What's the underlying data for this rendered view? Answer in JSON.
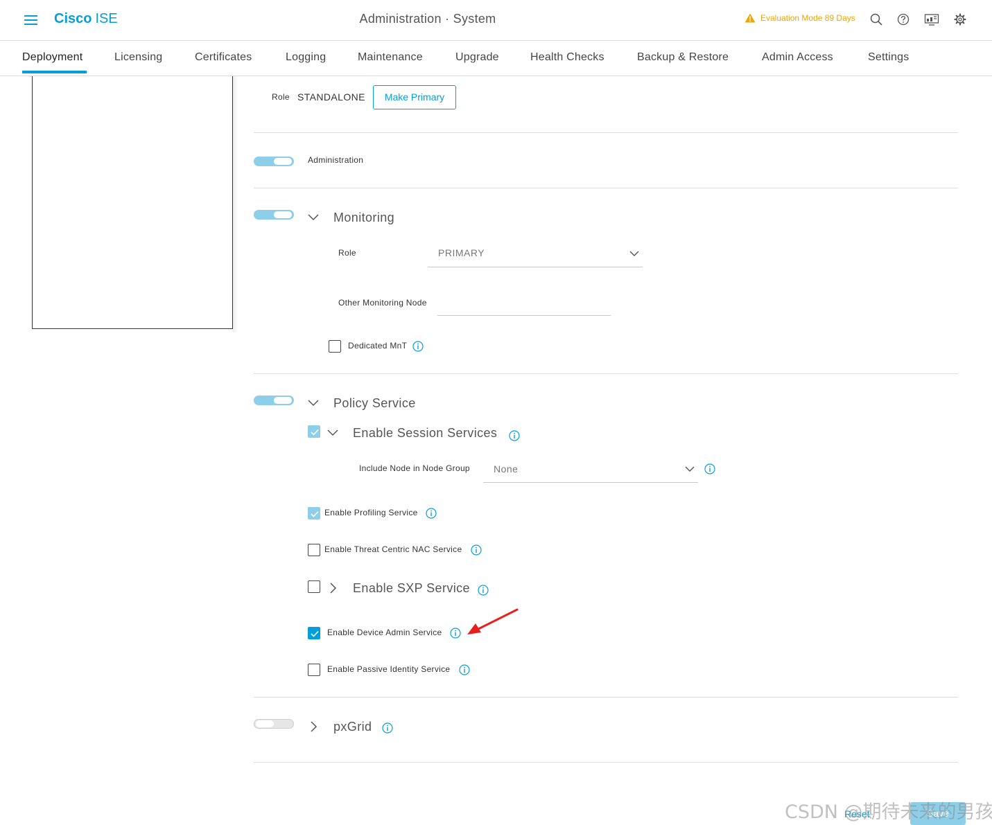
{
  "header": {
    "brand_bold": "Cisco",
    "brand_light": "ISE",
    "title": "Administration · System",
    "evaluation": "Evaluation Mode 89 Days",
    "icons": [
      "menu-icon",
      "warning-icon",
      "search-icon",
      "help-icon",
      "dashboard-icon",
      "gear-icon"
    ]
  },
  "tabs": [
    {
      "label": "Deployment",
      "active": true
    },
    {
      "label": "Licensing"
    },
    {
      "label": "Certificates"
    },
    {
      "label": "Logging"
    },
    {
      "label": "Maintenance"
    },
    {
      "label": "Upgrade"
    },
    {
      "label": "Health Checks"
    },
    {
      "label": "Backup & Restore"
    },
    {
      "label": "Admin Access"
    },
    {
      "label": "Settings"
    }
  ],
  "node": {
    "role_label": "Role",
    "role_value": "STANDALONE",
    "make_primary": "Make Primary"
  },
  "administration": {
    "label": "Administration",
    "enabled": true
  },
  "monitoring": {
    "label": "Monitoring",
    "enabled": true,
    "role_label": "Role",
    "role_value": "PRIMARY",
    "other_node_label": "Other Monitoring Node",
    "other_node_value": "",
    "dedicated_mnt": "Dedicated MnT",
    "dedicated_mnt_checked": false
  },
  "policy_service": {
    "label": "Policy Service",
    "enabled": true,
    "session_services": "Enable Session Services",
    "session_services_checked": true,
    "node_group_label": "Include Node in Node Group",
    "node_group_value": "None",
    "profiling": "Enable Profiling Service",
    "profiling_checked": true,
    "threat_centric": "Enable Threat Centric NAC Service",
    "threat_centric_checked": false,
    "sxp": "Enable SXP Service",
    "sxp_checked": false,
    "device_admin": "Enable Device Admin Service",
    "device_admin_checked": true,
    "passive_identity": "Enable Passive Identity Service",
    "passive_identity_checked": false
  },
  "pxgrid": {
    "label": "pxGrid",
    "enabled": false
  },
  "footer": {
    "reset": "Reset",
    "save": "Save"
  },
  "watermark": "CSDN @期待未来的男孩",
  "colors": {
    "accent": "#049fd9",
    "accent_light": "#8dcfe9",
    "warning": "#f0a500",
    "annotation_arrow": "#e8201d"
  }
}
